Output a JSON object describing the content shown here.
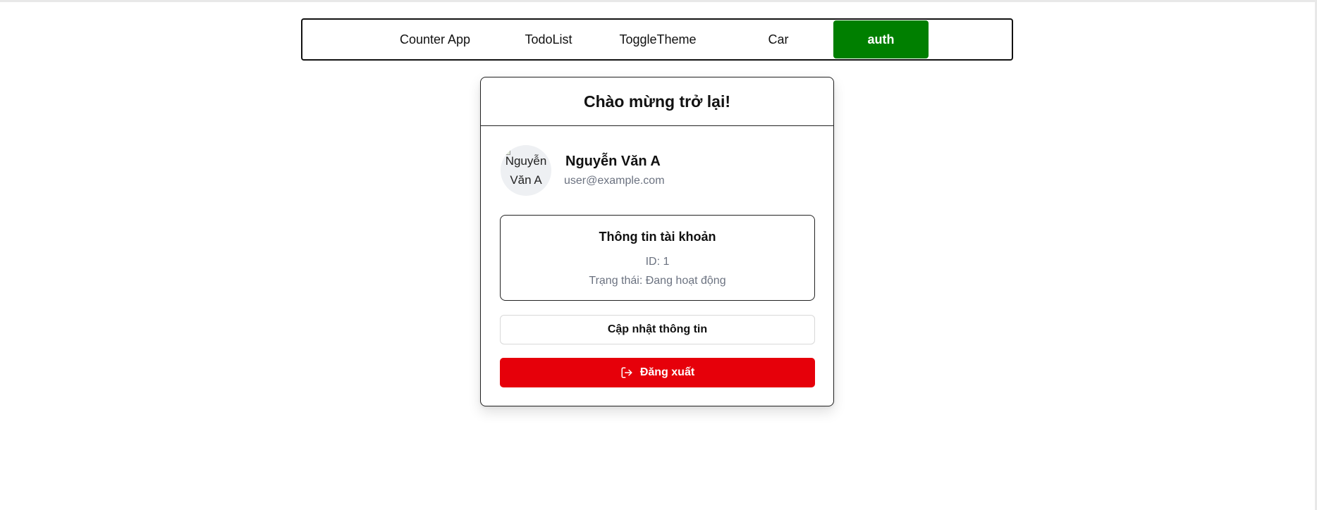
{
  "nav": {
    "items": [
      {
        "label": "Counter App",
        "active": false
      },
      {
        "label": "TodoList",
        "active": false
      },
      {
        "label": "ToggleTheme",
        "active": false
      },
      {
        "label": "Car",
        "active": false
      },
      {
        "label": "auth",
        "active": true
      }
    ],
    "active_color": "#007f00"
  },
  "card": {
    "title": "Chào mừng trở lại!",
    "user": {
      "name": "Nguyễn Văn A",
      "email": "user@example.com",
      "avatar_alt_line1": "Nguyễn",
      "avatar_alt_line2": "Văn A"
    },
    "account_info": {
      "title": "Thông tin tài khoản",
      "id_text": "ID: 1",
      "status_text": "Trạng thái: Đang hoạt động"
    },
    "update_button": "Cập nhật thông tin",
    "logout_button": "Đăng xuất",
    "logout_icon": "logout-icon",
    "logout_color": "#e6000a"
  }
}
